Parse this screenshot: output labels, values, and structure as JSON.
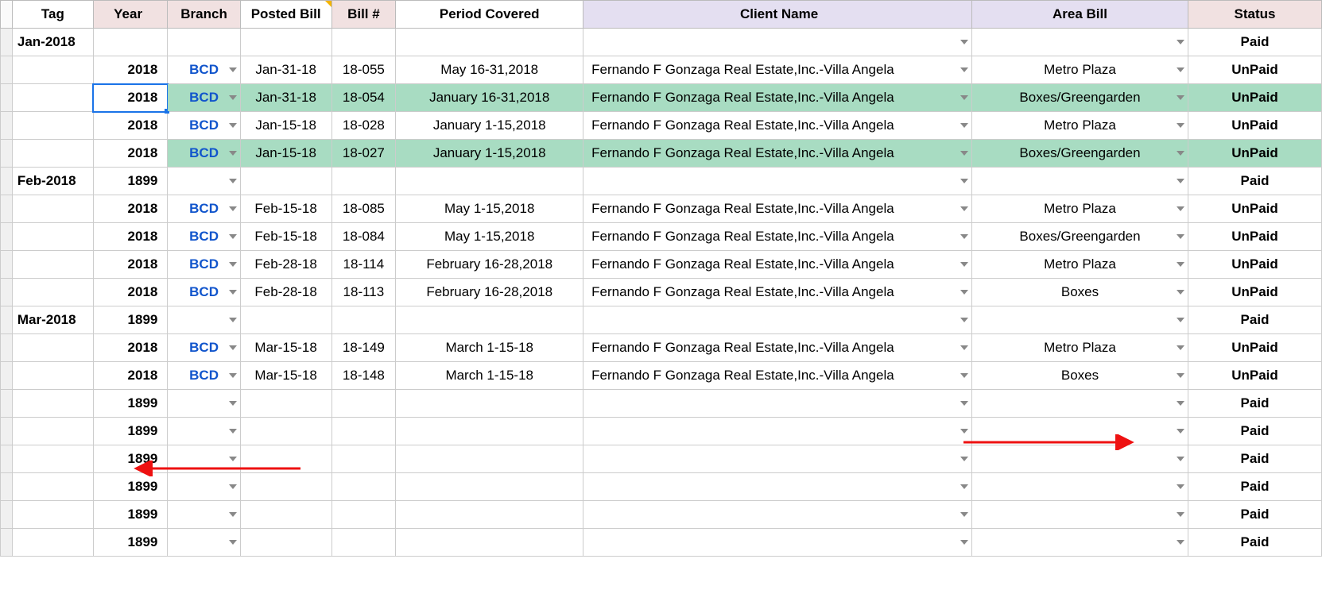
{
  "headers": {
    "tag": "Tag",
    "year": "Year",
    "branch": "Branch",
    "posted": "Posted Bill",
    "bill": "Bill #",
    "period": "Period Covered",
    "client": "Client Name",
    "area": "Area Bill",
    "status": "Status"
  },
  "rows": [
    {
      "tag": "Jan-2018",
      "year": "",
      "branch": "",
      "posted": "",
      "bill": "",
      "period": "",
      "client": "",
      "area": "",
      "status": "Paid",
      "branchDD": false,
      "clientDD": true,
      "areaDD": true
    },
    {
      "tag": "",
      "year": "2018",
      "branch": "BCD",
      "posted": "Jan-31-18",
      "bill": "18-055",
      "period": "May 16-31,2018",
      "client": "Fernando F Gonzaga Real Estate,Inc.-Villa Angela",
      "area": "Metro Plaza",
      "status": "UnPaid",
      "branchDD": true,
      "clientDD": true,
      "areaDD": true
    },
    {
      "tag": "",
      "year": "2018",
      "branch": "BCD",
      "posted": "Jan-31-18",
      "bill": "18-054",
      "period": "January 16-31,2018",
      "client": "Fernando F Gonzaga Real Estate,Inc.-Villa Angela",
      "area": "Boxes/Greengarden",
      "status": "UnPaid",
      "branchDD": true,
      "clientDD": true,
      "areaDD": true,
      "hl": true,
      "sel": true
    },
    {
      "tag": "",
      "year": "2018",
      "branch": "BCD",
      "posted": "Jan-15-18",
      "bill": "18-028",
      "period": "January 1-15,2018",
      "client": "Fernando F Gonzaga Real Estate,Inc.-Villa Angela",
      "area": "Metro Plaza",
      "status": "UnPaid",
      "branchDD": true,
      "clientDD": true,
      "areaDD": true
    },
    {
      "tag": "",
      "year": "2018",
      "branch": "BCD",
      "posted": "Jan-15-18",
      "bill": "18-027",
      "period": "January 1-15,2018",
      "client": "Fernando F Gonzaga Real Estate,Inc.-Villa Angela",
      "area": "Boxes/Greengarden",
      "status": "UnPaid",
      "branchDD": true,
      "clientDD": true,
      "areaDD": true,
      "hl": true
    },
    {
      "tag": "Feb-2018",
      "year": "1899",
      "branch": "",
      "posted": "",
      "bill": "",
      "period": "",
      "client": "",
      "area": "",
      "status": "Paid",
      "branchDD": true,
      "clientDD": true,
      "areaDD": true
    },
    {
      "tag": "",
      "year": "2018",
      "branch": "BCD",
      "posted": "Feb-15-18",
      "bill": "18-085",
      "period": "May 1-15,2018",
      "client": "Fernando F Gonzaga Real Estate,Inc.-Villa Angela",
      "area": "Metro Plaza",
      "status": "UnPaid",
      "branchDD": true,
      "clientDD": true,
      "areaDD": true
    },
    {
      "tag": "",
      "year": "2018",
      "branch": "BCD",
      "posted": "Feb-15-18",
      "bill": "18-084",
      "period": "May 1-15,2018",
      "client": "Fernando F Gonzaga Real Estate,Inc.-Villa Angela",
      "area": "Boxes/Greengarden",
      "status": "UnPaid",
      "branchDD": true,
      "clientDD": true,
      "areaDD": true
    },
    {
      "tag": "",
      "year": "2018",
      "branch": "BCD",
      "posted": "Feb-28-18",
      "bill": "18-114",
      "period": "February 16-28,2018",
      "client": "Fernando F Gonzaga Real Estate,Inc.-Villa Angela",
      "area": "Metro Plaza",
      "status": "UnPaid",
      "branchDD": true,
      "clientDD": true,
      "areaDD": true
    },
    {
      "tag": "",
      "year": "2018",
      "branch": "BCD",
      "posted": "Feb-28-18",
      "bill": "18-113",
      "period": "February 16-28,2018",
      "client": "Fernando F Gonzaga Real Estate,Inc.-Villa Angela",
      "area": "Boxes",
      "status": "UnPaid",
      "branchDD": true,
      "clientDD": true,
      "areaDD": true
    },
    {
      "tag": "Mar-2018",
      "year": "1899",
      "branch": "",
      "posted": "",
      "bill": "",
      "period": "",
      "client": "",
      "area": "",
      "status": "Paid",
      "branchDD": true,
      "clientDD": true,
      "areaDD": true
    },
    {
      "tag": "",
      "year": "2018",
      "branch": "BCD",
      "posted": "Mar-15-18",
      "bill": "18-149",
      "period": "March 1-15-18",
      "client": "Fernando F Gonzaga Real Estate,Inc.-Villa Angela",
      "area": "Metro Plaza",
      "status": "UnPaid",
      "branchDD": true,
      "clientDD": true,
      "areaDD": true
    },
    {
      "tag": "",
      "year": "2018",
      "branch": "BCD",
      "posted": "Mar-15-18",
      "bill": "18-148",
      "period": "March 1-15-18",
      "client": "Fernando F Gonzaga Real Estate,Inc.-Villa Angela",
      "area": "Boxes",
      "status": "UnPaid",
      "branchDD": true,
      "clientDD": true,
      "areaDD": true
    },
    {
      "tag": "",
      "year": "1899",
      "branch": "",
      "posted": "",
      "bill": "",
      "period": "",
      "client": "",
      "area": "",
      "status": "Paid",
      "branchDD": true,
      "clientDD": true,
      "areaDD": true
    },
    {
      "tag": "",
      "year": "1899",
      "branch": "",
      "posted": "",
      "bill": "",
      "period": "",
      "client": "",
      "area": "",
      "status": "Paid",
      "branchDD": true,
      "clientDD": true,
      "areaDD": true
    },
    {
      "tag": "",
      "year": "1899",
      "branch": "",
      "posted": "",
      "bill": "",
      "period": "",
      "client": "",
      "area": "",
      "status": "Paid",
      "branchDD": true,
      "clientDD": true,
      "areaDD": true
    },
    {
      "tag": "",
      "year": "1899",
      "branch": "",
      "posted": "",
      "bill": "",
      "period": "",
      "client": "",
      "area": "",
      "status": "Paid",
      "branchDD": true,
      "clientDD": true,
      "areaDD": true
    },
    {
      "tag": "",
      "year": "1899",
      "branch": "",
      "posted": "",
      "bill": "",
      "period": "",
      "client": "",
      "area": "",
      "status": "Paid",
      "branchDD": true,
      "clientDD": true,
      "areaDD": true
    },
    {
      "tag": "",
      "year": "1899",
      "branch": "",
      "posted": "",
      "bill": "",
      "period": "",
      "client": "",
      "area": "",
      "status": "Paid",
      "branchDD": true,
      "clientDD": true,
      "areaDD": true
    }
  ]
}
